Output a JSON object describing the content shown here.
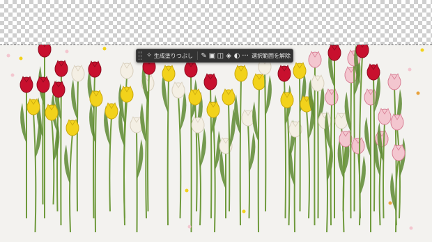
{
  "canvas": {
    "transparent_pattern": "checkerboard",
    "image_layer": "tulip-photo"
  },
  "task_bar": {
    "primary_action_label": "生成塗りつぶし",
    "secondary_action_label": "選択範囲を解除",
    "icons": [
      "grip-icon",
      "generative-fill-icon",
      "brush-icon",
      "transform-icon",
      "crop-icon",
      "fill-icon",
      "adjustment-icon",
      "more-icon"
    ]
  },
  "colors": {
    "toolbar_bg": "#323232",
    "toolbar_text": "#e6e6e6",
    "photo_bg": "#f3f2ef"
  }
}
